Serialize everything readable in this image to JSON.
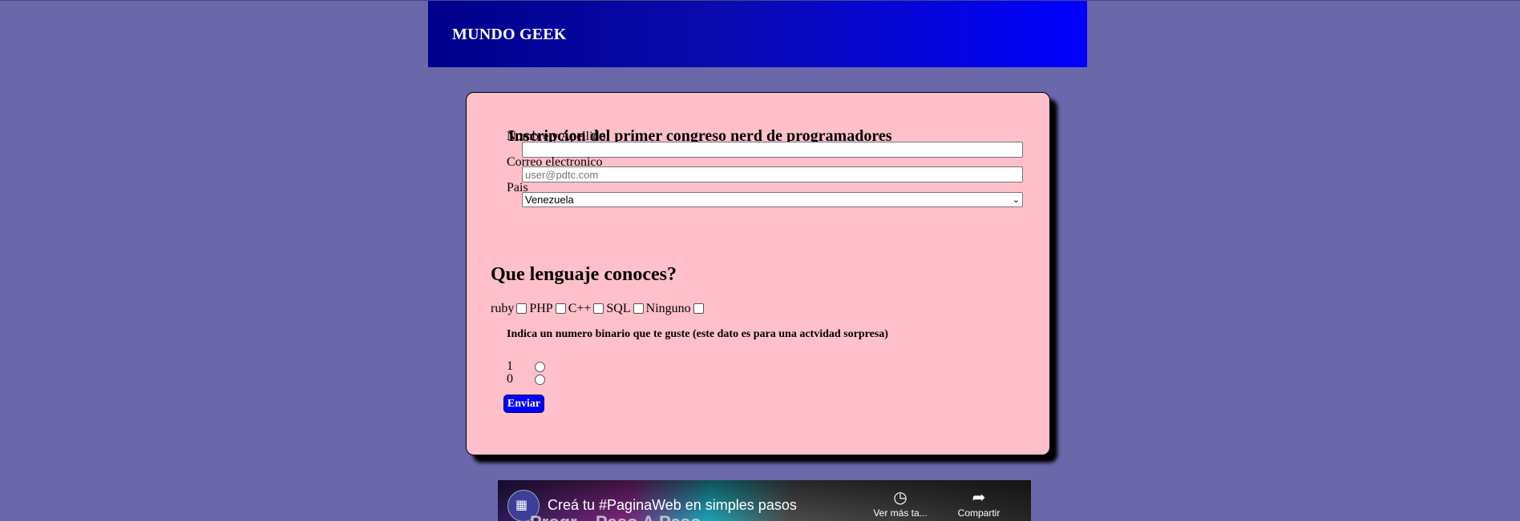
{
  "header": {
    "brand": "MUNDO GEEK"
  },
  "form": {
    "title": "Inscripcion del primer congreso nerd de programadores",
    "name_label": "Nombre y Apellido",
    "name_value": "",
    "email_label": "Correo electronico",
    "email_placeholder": "user@pdtc.com",
    "country_label": "Pais",
    "country_selected": "Venezuela",
    "languages_heading": "Que lenguaje conoces?",
    "languages": [
      "ruby",
      "PHP",
      "C++",
      "SQL",
      "Ninguno"
    ],
    "binary_title": "Indica un numero binario que te guste (este dato es para una actvidad sorpresa)",
    "binary_options": [
      "1",
      "0"
    ],
    "submit_label": "Enviar"
  },
  "video": {
    "title": "Creá tu #PaginaWeb en simples pasos",
    "subtitle": "Progr... Paso A Paso",
    "watch_later_label": "Ver más ta...",
    "share_label": "Compartir",
    "watch_later_icon": "clock-icon",
    "share_icon": "share-arrow-icon"
  }
}
